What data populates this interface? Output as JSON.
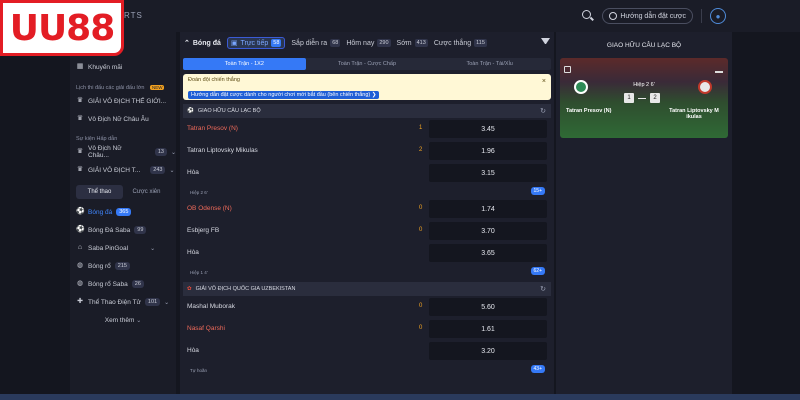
{
  "brand": {
    "logo": "UU88",
    "sub": "RTS"
  },
  "header": {
    "guide_label": "Hướng dẫn đặt cược"
  },
  "sidebar": {
    "promo": "Khuyến mãi",
    "schedule_title": "Lịch thi đấu các giải đấu lớn",
    "new_badge": "NEW",
    "top_items": [
      {
        "label": "GIẢI VÔ ĐỊCH THẾ GIỚI..."
      },
      {
        "label": "Vô Địch Nữ Châu Âu"
      }
    ],
    "highlight_title": "Sự kiện Hấp dẫn",
    "highlight_items": [
      {
        "label": "Vô Địch Nữ Châu...",
        "count": "13"
      },
      {
        "label": "GIẢI VÔ ĐỊCH T...",
        "count": "243"
      }
    ],
    "tabs": [
      "Thể thao",
      "Cược xiên"
    ],
    "sports": [
      {
        "label": "Bóng đá",
        "count": "365"
      },
      {
        "label": "Bóng Đá Saba",
        "count": "99"
      },
      {
        "label": "Saba PinGoal",
        "count": ""
      },
      {
        "label": "Bóng rổ",
        "count": "215"
      },
      {
        "label": "Bóng rổ Saba",
        "count": "26"
      },
      {
        "label": "Thể Thao Điện Tử",
        "count": "101"
      }
    ],
    "more": "Xem thêm"
  },
  "filter_bar": {
    "title": "Bóng đá",
    "items": [
      {
        "label": "Trực tiếp",
        "count": "58"
      },
      {
        "label": "Sắp diễn ra",
        "count": "68"
      },
      {
        "label": "Hôm nay",
        "count": "290"
      },
      {
        "label": "Sớm",
        "count": "413"
      },
      {
        "label": "Cược thắng",
        "count": "115"
      }
    ]
  },
  "market_tabs": [
    "Toàn Trận - 1X2",
    "Toàn Trận - Cược Chấp",
    "Toàn Trận - Tài/Xỉu"
  ],
  "notice": {
    "title": "Đoán đội chiến thắng",
    "link": "Hướng dẫn đặt cược dành cho người chơi mới bắt đầu (bên chiến thắng) ❯"
  },
  "leagues": [
    {
      "name": "GIAO HỮU CÂU LẠC BỘ",
      "matches": [
        {
          "rows": [
            {
              "team": "Tatran Presov (N)",
              "score": "1",
              "odd": "3.45",
              "red": true
            },
            {
              "team": "Tatran Liptovsky Mikulas",
              "score": "2",
              "odd": "1.96",
              "red": false
            },
            {
              "team": "Hòa",
              "score": "",
              "odd": "3.15",
              "red": false
            }
          ],
          "meta": "Hiệp 2 6'",
          "more": "15+"
        },
        {
          "rows": [
            {
              "team": "OB Odense (N)",
              "score": "0",
              "odd": "1.74",
              "red": true
            },
            {
              "team": "Esbjerg FB",
              "score": "0",
              "odd": "3.70",
              "red": false
            },
            {
              "team": "Hòa",
              "score": "",
              "odd": "3.65",
              "red": false
            }
          ],
          "meta": "Hiệp 1 4'",
          "more": "62+"
        }
      ]
    },
    {
      "name": "GIẢI VÔ ĐỊCH QUỐC GIA UZBEKISTAN",
      "matches": [
        {
          "rows": [
            {
              "team": "Mashal Muborak",
              "score": "0",
              "odd": "5.60",
              "red": false
            },
            {
              "team": "Nasaf Qarshi",
              "score": "0",
              "odd": "1.61",
              "red": true
            },
            {
              "team": "Hòa",
              "score": "",
              "odd": "3.20",
              "red": false
            }
          ],
          "meta": "Tự hoãn",
          "more": "43+"
        }
      ]
    }
  ],
  "right_panel": {
    "title": "GIAO HỮU CÂU LẠC BỘ",
    "half": "Hiệp 2 6'",
    "home": "Tatran Presov (N)",
    "away": "Tatran Liptovsky M ikulas",
    "home_score": "1",
    "away_score": "2"
  }
}
